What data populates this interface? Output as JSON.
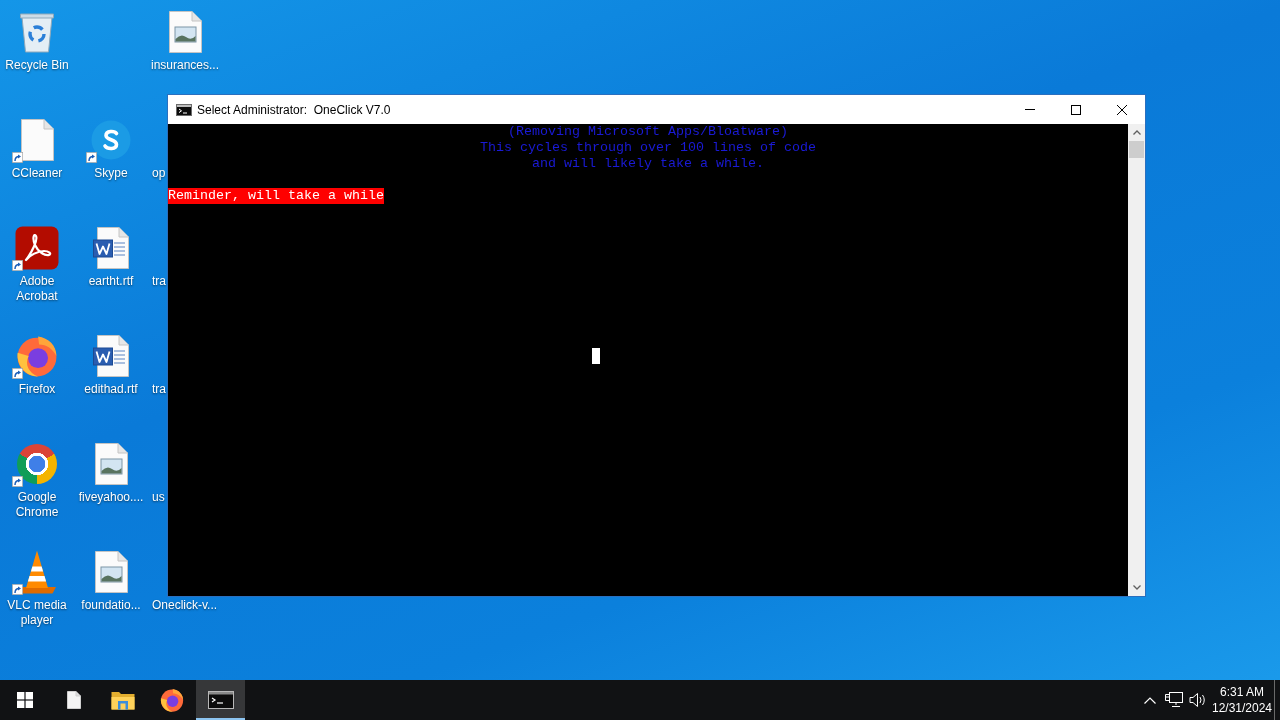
{
  "desktop": {
    "columns": [
      [
        {
          "label": "Recycle Bin",
          "kind": "recycle-bin",
          "shortcut": false
        },
        {
          "label": "CCleaner",
          "kind": "blank-file",
          "shortcut": true
        },
        {
          "label": "Adobe Acrobat",
          "kind": "pdf-app",
          "shortcut": true
        },
        {
          "label": "Firefox",
          "kind": "firefox",
          "shortcut": true
        },
        {
          "label": "Google Chrome",
          "kind": "chrome",
          "shortcut": true
        },
        {
          "label": "VLC media player",
          "kind": "cone",
          "shortcut": true
        }
      ],
      [
        {
          "label": "Skype",
          "kind": "skype",
          "shortcut": true
        },
        {
          "label": "eartht.rtf",
          "kind": "word-doc",
          "shortcut": false
        },
        {
          "label": "edithad.rtf",
          "kind": "word-doc",
          "shortcut": false
        },
        {
          "label": "fiveyahoo....",
          "kind": "image-file",
          "shortcut": false
        },
        {
          "label": "foundatio...",
          "kind": "image-file",
          "shortcut": false
        }
      ],
      [
        {
          "label": "insurances...",
          "kind": "image-file",
          "shortcut": false
        },
        {
          "label": "op",
          "kind": "covered"
        },
        {
          "label": "tra",
          "kind": "covered"
        },
        {
          "label": "tra",
          "kind": "covered"
        },
        {
          "label": "us",
          "kind": "covered"
        },
        {
          "label": "Oneclick-v...",
          "kind": "covered"
        }
      ]
    ]
  },
  "window": {
    "title": "Select Administrator:  OneClick V7.0",
    "console": {
      "banner": [
        "(Removing Microsoft Apps/Bloatware)",
        "This cycles through over 100 lines of code",
        "and will likely take a while."
      ],
      "lines": [
        {
          "text": "Reminder, will take a while",
          "highlighted": true
        }
      ]
    }
  },
  "taskbar": {
    "apps": [
      {
        "kind": "file",
        "selected": false
      },
      {
        "kind": "folder",
        "selected": false
      },
      {
        "kind": "firefox",
        "selected": false
      },
      {
        "kind": "terminal",
        "selected": true
      }
    ],
    "clock": {
      "time": "6:31 AM",
      "date": "12/31/2024"
    }
  }
}
